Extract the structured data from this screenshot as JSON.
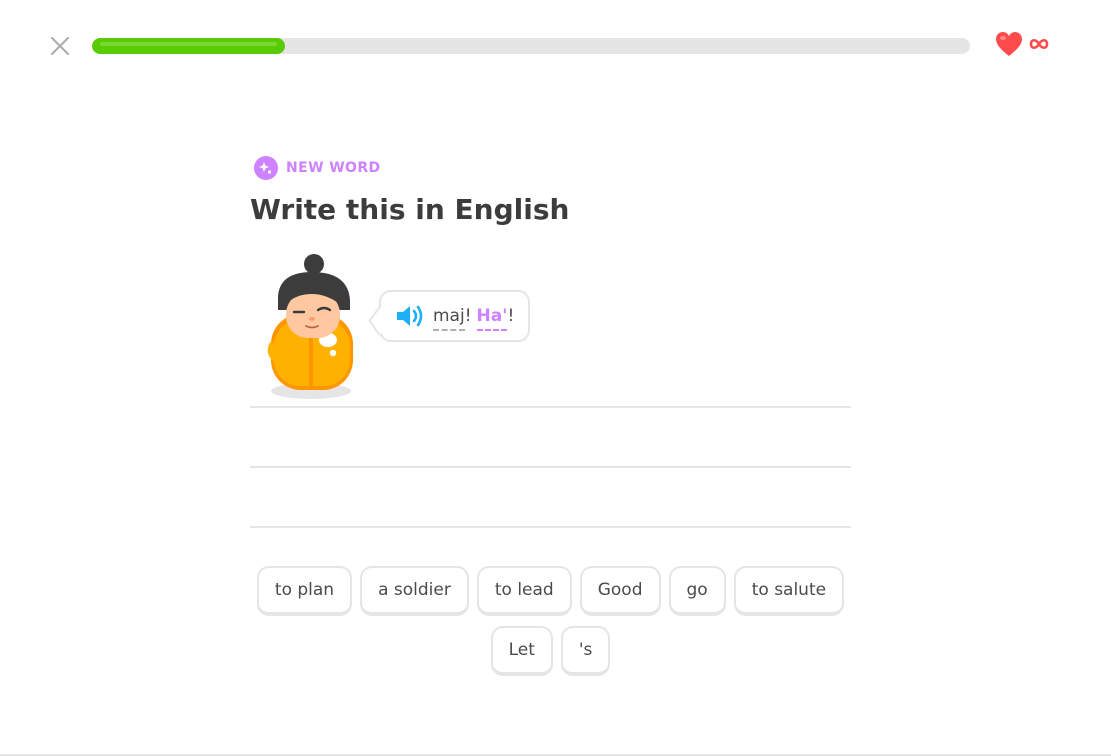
{
  "header": {
    "progress": 0.22,
    "hearts": "∞",
    "colors": {
      "progress": "#58cc02",
      "track": "#e5e5e5",
      "heart": "#ff4b4b"
    }
  },
  "challenge": {
    "badge": "NEW WORD",
    "title": "Write this in English",
    "phrase": [
      {
        "text": "maj",
        "new": false
      },
      {
        "punct": "!"
      },
      {
        "text": "Ha'",
        "new": true
      },
      {
        "punct": "!"
      }
    ],
    "phrase_tokens": [
      "maj",
      "!",
      "Ha'",
      "!"
    ]
  },
  "word_bank": [
    "to plan",
    "a soldier",
    "to lead",
    "Good",
    "go",
    "to salute",
    "Let",
    "'s"
  ],
  "colors": {
    "accent": "#ce82ff",
    "speaker": "#1cb0f6",
    "text": "#3c3c3c",
    "border": "#e5e5e5"
  }
}
